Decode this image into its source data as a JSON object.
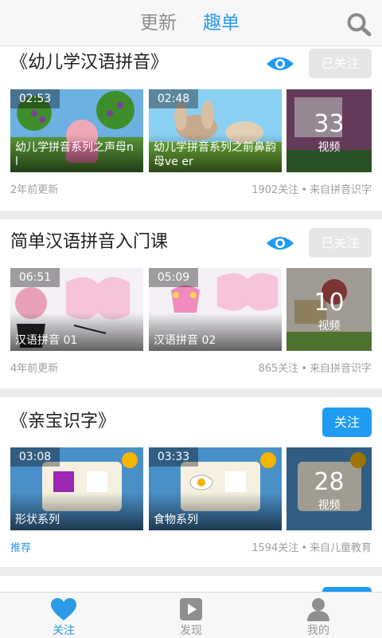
{
  "header": {
    "tabs": [
      {
        "label": "更新",
        "active": false
      },
      {
        "label": "趣单",
        "active": true
      }
    ],
    "search_icon": "search-icon",
    "colors": {
      "active_tab": "#2b9be8",
      "inactive_tab": "#8c8c8c"
    }
  },
  "cards": [
    {
      "title": "《幼儿学汉语拼音》",
      "watch_icon": "eye-icon",
      "follow_label": "已关注",
      "followed": true,
      "videos": [
        {
          "duration": "02:53",
          "caption": "幼儿学拼音系列之声母n l"
        },
        {
          "duration": "02:48",
          "caption": "幼儿学拼音系列之前鼻韵母ve er"
        }
      ],
      "more": {
        "count": "33",
        "label": "视频"
      },
      "meta_left": "2年前更新",
      "followers": "1902关注",
      "separator": "•",
      "source": "来自拼音识字"
    },
    {
      "title": "简单汉语拼音入门课",
      "watch_icon": "eye-icon",
      "follow_label": "已关注",
      "followed": true,
      "videos": [
        {
          "duration": "06:51",
          "caption": "汉语拼音 01"
        },
        {
          "duration": "05:09",
          "caption": "汉语拼音 02"
        }
      ],
      "more": {
        "count": "10",
        "label": "视频"
      },
      "meta_left": "4年前更新",
      "followers": "865关注",
      "separator": "•",
      "source": "来自拼音识字"
    },
    {
      "title": "《亲宝识字》",
      "follow_label": "关注",
      "followed": false,
      "videos": [
        {
          "duration": "03:08",
          "caption": "形状系列"
        },
        {
          "duration": "03:33",
          "caption": "食物系列"
        }
      ],
      "more": {
        "count": "28",
        "label": "视频"
      },
      "meta_left": "推荐",
      "followers": "1594关注",
      "separator": "•",
      "source": "来自儿童教育"
    }
  ],
  "bottom_nav": [
    {
      "label": "关注",
      "icon": "heart-icon",
      "active": true
    },
    {
      "label": "发现",
      "icon": "play-icon",
      "active": false
    },
    {
      "label": "我的",
      "icon": "person-icon",
      "active": false
    }
  ],
  "colors": {
    "accent": "#1f9cf0",
    "followed_button": "#e6e6e6",
    "background": "#ececec"
  }
}
